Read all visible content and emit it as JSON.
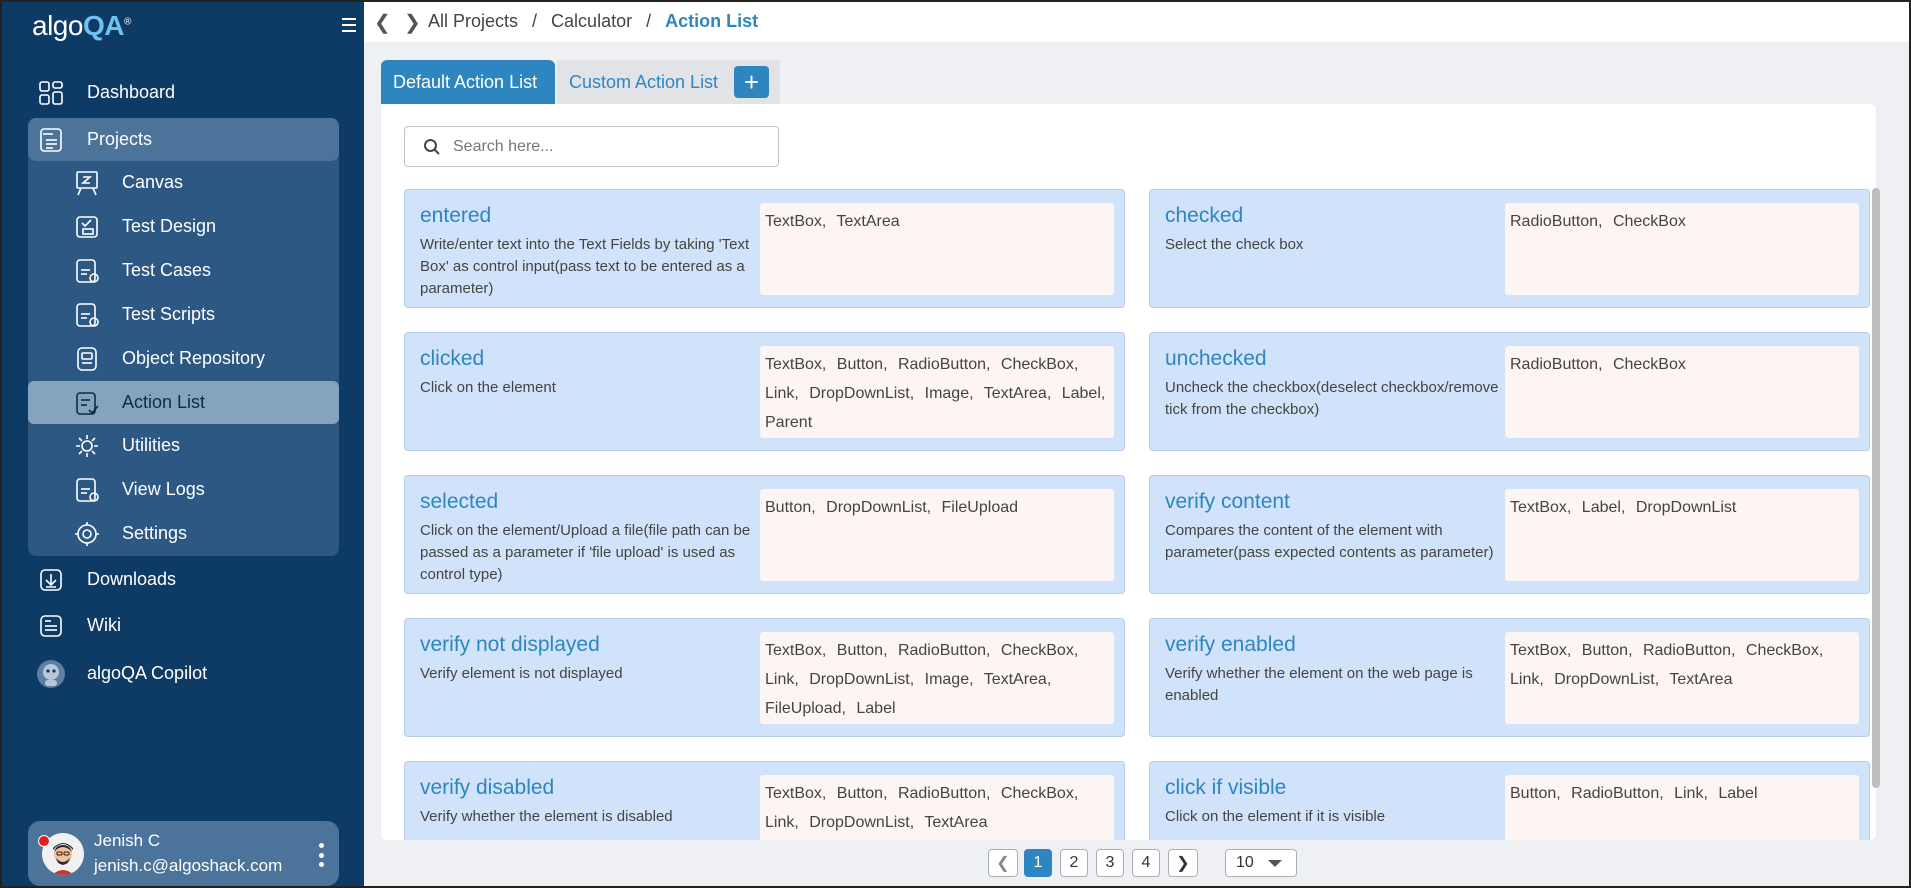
{
  "app": {
    "logo_prefix": "algo",
    "logo_suffix": "QA",
    "logo_mark": "®"
  },
  "sidebar": {
    "top_items": [
      {
        "label": "Dashboard",
        "icon": "dashboard-icon"
      },
      {
        "label": "Projects",
        "icon": "project-icon"
      }
    ],
    "project_items": [
      {
        "label": "Canvas",
        "icon": "canvas-icon"
      },
      {
        "label": "Test Design",
        "icon": "test-design-icon"
      },
      {
        "label": "Test Cases",
        "icon": "bdd-icon"
      },
      {
        "label": "Test Scripts",
        "icon": "script-icon"
      },
      {
        "label": "Object Repository",
        "icon": "repository-icon"
      },
      {
        "label": "Action List",
        "icon": "action-list-icon"
      },
      {
        "label": "Utilities",
        "icon": "utilities-icon"
      },
      {
        "label": "View Logs",
        "icon": "logs-icon"
      },
      {
        "label": "Settings",
        "icon": "settings-icon"
      }
    ],
    "bottom_items": [
      {
        "label": "Downloads",
        "icon": "download-icon"
      },
      {
        "label": "Wiki",
        "icon": "wiki-icon"
      },
      {
        "label": "algoQA Copilot",
        "icon": "copilot-icon"
      }
    ],
    "user": {
      "name": "Jenish C",
      "email": "jenish.c@algoshack.com"
    }
  },
  "breadcrumb": {
    "items": [
      "All Projects",
      "Calculator"
    ],
    "separator": "/",
    "current": "Action List"
  },
  "tabs": {
    "default_label": "Default Action List",
    "custom_label": "Custom Action List",
    "add_label": "+"
  },
  "search": {
    "placeholder": "Search here...",
    "value": ""
  },
  "actions": [
    {
      "title": "entered",
      "description": "Write/enter text into the Text Fields by taking 'Text Box' as control input(pass text to be entered as a parameter)",
      "controls": "TextBox,  TextArea"
    },
    {
      "title": "checked",
      "description": "Select the check box",
      "controls": "RadioButton,  CheckBox"
    },
    {
      "title": "clicked",
      "description": "Click on the element",
      "controls": "TextBox,  Button,  RadioButton,  CheckBox,  Link,  DropDownList,  Image,  TextArea,  Label,  Parent"
    },
    {
      "title": "unchecked",
      "description": "Uncheck the checkbox(deselect checkbox/remove tick from the checkbox)",
      "controls": "RadioButton,  CheckBox"
    },
    {
      "title": "selected",
      "description": "Click on the element/Upload a file(file path can be passed as a parameter if 'file upload' is used as control type)",
      "controls": "Button,  DropDownList,  FileUpload"
    },
    {
      "title": "verify content",
      "description": "Compares the content of the element with parameter(pass expected contents as parameter)",
      "controls": "TextBox,  Label,  DropDownList"
    },
    {
      "title": "verify not displayed",
      "description": "Verify element is not displayed",
      "controls": "TextBox,  Button,  RadioButton,  CheckBox,  Link,  DropDownList,  Image,  TextArea,  FileUpload,  Label"
    },
    {
      "title": "verify enabled",
      "description": "Verify whether the element on the web page is enabled",
      "controls": "TextBox,  Button,  RadioButton,  CheckBox,  Link,  DropDownList,  TextArea"
    },
    {
      "title": "verify disabled",
      "description": "Verify whether the element is disabled",
      "controls": "TextBox,  Button,  RadioButton,  CheckBox,  Link,  DropDownList,  TextArea"
    },
    {
      "title": "click if visible",
      "description": "Click on the element if it is visible",
      "controls": "Button,  RadioButton,  Link,  Label"
    }
  ],
  "pagination": {
    "pages": [
      "1",
      "2",
      "3",
      "4"
    ],
    "current": "1",
    "page_size": "10"
  },
  "colors": {
    "sidebar": "#0e3a66",
    "accent": "#2e86c1",
    "card": "#d1e3fa",
    "control_box": "#fdf5f3"
  }
}
